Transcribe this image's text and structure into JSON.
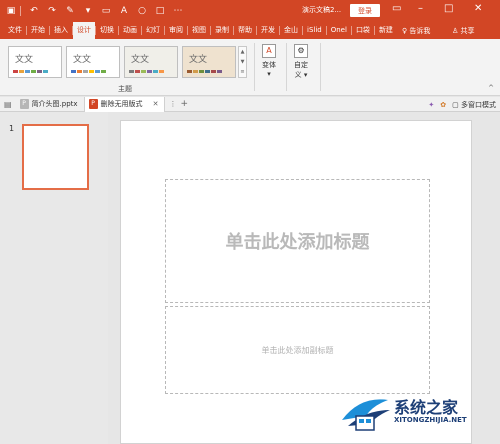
{
  "titlebar": {
    "title": "演示文稿2...",
    "login_label": "登录",
    "quick_access": [
      "save-icon",
      "undo-icon",
      "redo-icon",
      "format-painter-icon"
    ]
  },
  "tabs": [
    "文件",
    "开始",
    "插入",
    "设计",
    "切换",
    "动画",
    "幻灯",
    "审阅",
    "视图",
    "录制",
    "帮助",
    "开发",
    "金山",
    "iSlid",
    "Onel",
    "口袋",
    "新建"
  ],
  "active_tab": "设计",
  "tell_me": "告诉我",
  "share": "共享",
  "ribbon": {
    "themes": [
      {
        "text": "文文",
        "bg": "#ffffff"
      },
      {
        "text": "文文",
        "bg": "#ffffff"
      },
      {
        "text": "文文",
        "bg": "#f0efe9"
      },
      {
        "text": "文文",
        "bg": "#efe2cf"
      }
    ],
    "group_label": "主题",
    "variants_label": "变体",
    "custom_label_1": "自定",
    "custom_label_2": "义"
  },
  "docbar": {
    "tabs": [
      "简介头图.pptx",
      "删除无用版式"
    ],
    "multi_window_label": "多窗口模式"
  },
  "slide_panel": {
    "slide_number": "1"
  },
  "slide": {
    "title_placeholder": "单击此处添加标题",
    "subtitle_placeholder": "单击此处添加副标题"
  },
  "watermark": {
    "text": "系统之家",
    "sub": "XITONGZHIJIA.NET"
  },
  "colors": {
    "accent": "#d24625",
    "thumb_border": "#e46d47"
  }
}
